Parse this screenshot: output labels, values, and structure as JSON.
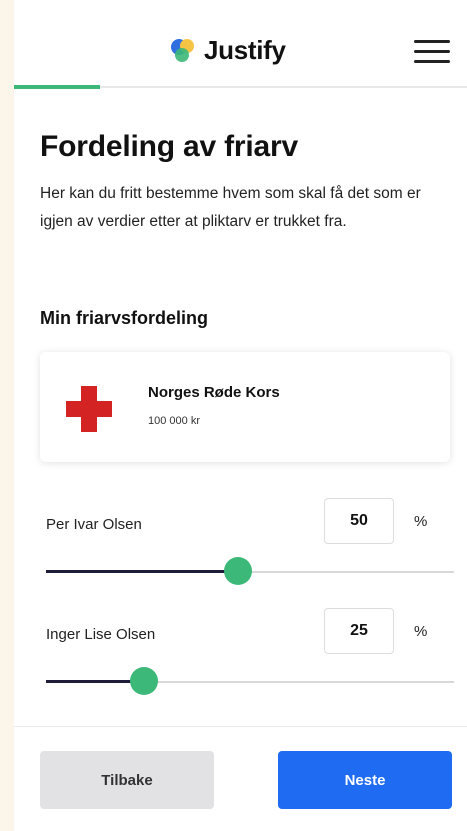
{
  "header": {
    "app_name": "Justify",
    "logo_icon": "justify-logo-icon",
    "menu_icon": "hamburger-menu-icon",
    "progress_fraction": 0.19
  },
  "page": {
    "title": "Fordeling av friarv",
    "intro": "Her kan du fritt bestemme hvem som skal få det som er igjen av verdier etter at pliktarv er trukket fra."
  },
  "distribution": {
    "section_title": "Min friarvsfordeling",
    "charity": {
      "name": "Norges Røde Kors",
      "amount": "100 000 kr",
      "icon": "red-cross-icon"
    },
    "heirs": [
      {
        "name": "Per Ivar Olsen",
        "percent": "50",
        "percent_sign": "%",
        "slider_value": 0.47
      },
      {
        "name": "Inger Lise Olsen",
        "percent": "25",
        "percent_sign": "%",
        "slider_value": 0.24
      }
    ]
  },
  "footer": {
    "back_label": "Tilbake",
    "next_label": "Neste"
  },
  "colors": {
    "accent_green": "#3cb878",
    "primary_blue": "#1f6bf2",
    "red_cross": "#d42323",
    "background": "#fbf5ea"
  }
}
